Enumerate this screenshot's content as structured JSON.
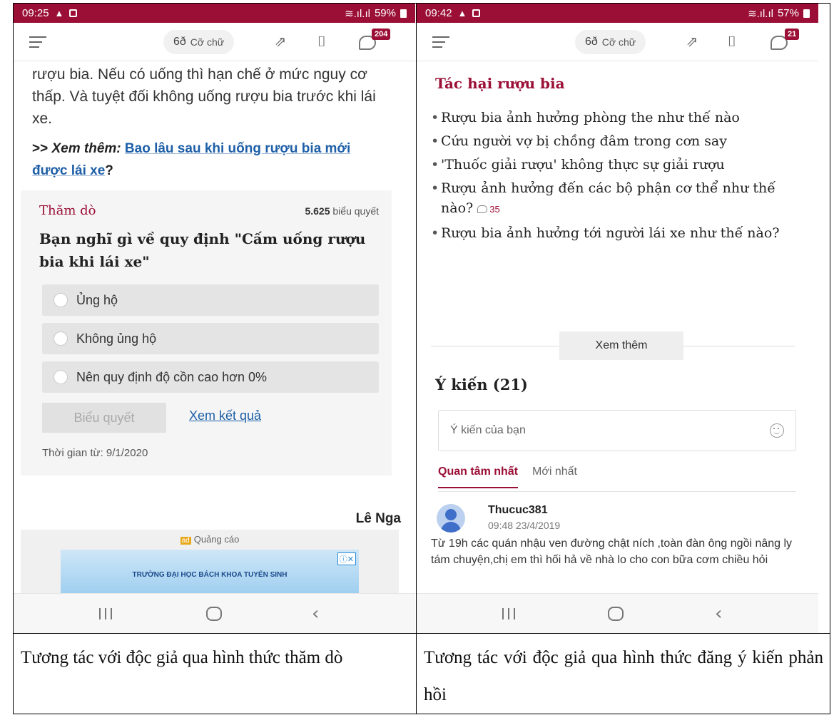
{
  "left": {
    "status": {
      "time": "09:25",
      "battery": "59%"
    },
    "toolbar": {
      "font_label": "Cỡ chữ",
      "comment_count": "204"
    },
    "paragraph": "rượu bia. Nếu có uống thì hạn chế ở mức nguy cơ thấp. Và tuyệt đối không uống rượu bia trước khi lái xe.",
    "see_more": {
      "prefix": ">> ",
      "label": "Xem thêm:",
      "link": "Bao lâu sau khi uống rượu bia mới được lái xe",
      "suffix": "?"
    },
    "poll": {
      "label": "Thăm dò",
      "votes_count": "5.625",
      "votes_unit": "biểu quyết",
      "question": "Bạn nghĩ gì về quy định \"Cấm uống rượu bia khi lái xe\"",
      "options": [
        "Ủng hộ",
        "Không ủng hộ",
        "Nên quy định độ cồn cao hơn 0%"
      ],
      "vote_button": "Biểu quyết",
      "result_link": "Xem kết quả",
      "time": "Thời gian từ: 9/1/2020"
    },
    "author": "Lê Nga",
    "ad": {
      "label": "Quảng cáo",
      "banner_text": "TRƯỜNG ĐẠI HỌC BÁCH KHOA TUYỂN SINH"
    }
  },
  "right": {
    "status": {
      "time": "09:42",
      "battery": "57%"
    },
    "toolbar": {
      "font_label": "Cỡ chữ",
      "comment_count": "21"
    },
    "related_title": "Tác hại rượu bia",
    "related": [
      {
        "text": "Rượu bia ảnh hưởng phòng the như thế nào",
        "count": ""
      },
      {
        "text": "Cứu người vợ bị chồng đâm trong cơn say",
        "count": ""
      },
      {
        "text": "'Thuốc giải rượu' không thực sự giải rượu",
        "count": ""
      },
      {
        "text": "Rượu ảnh hưởng đến các bộ phận cơ thể như thế nào?",
        "count": "35"
      },
      {
        "text": "Rượu bia ảnh hưởng tới người lái xe như thế nào?",
        "count": ""
      }
    ],
    "more_button": "Xem thêm",
    "opinion_title": "Ý kiến (21)",
    "opinion_placeholder": "Ý kiến của bạn",
    "tabs": [
      "Quan tâm nhất",
      "Mới nhất"
    ],
    "comment": {
      "user": "Thucuc381",
      "time": "09:48 23/4/2019",
      "text": "Từ 19h các quán nhậu ven đường chật ních ,toàn đàn ông ngồi nâng ly tám chuyện,chị em thì hối hả về nhà lo cho con bữa cơm chiều hỏi"
    }
  },
  "captions": {
    "left": "Tương tác với độc giả qua hình thức thăm dò",
    "right": "Tương tác với độc giả qua hình thức đăng ý kiến phản hồi"
  },
  "colors": {
    "brand": "#9b0f36",
    "link": "#1e5fa7"
  }
}
